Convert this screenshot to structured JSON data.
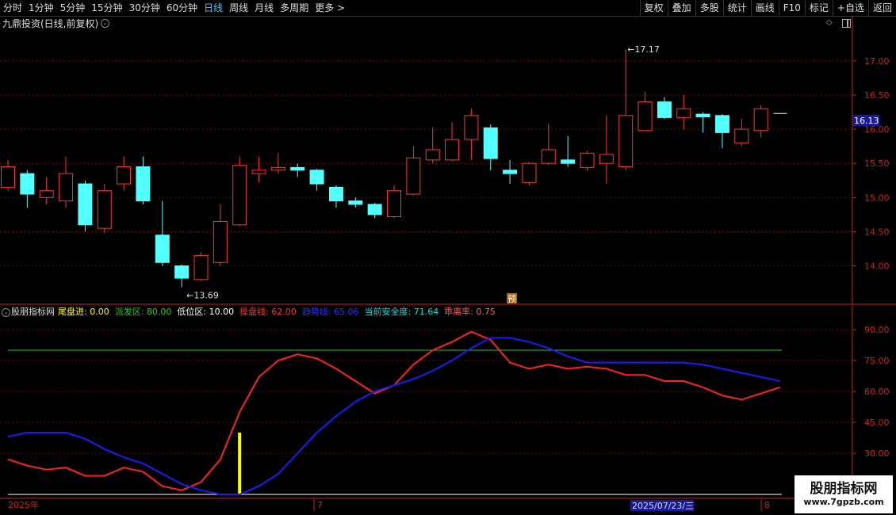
{
  "toolbar": {
    "periods": [
      "分时",
      "1分钟",
      "5分钟",
      "15分钟",
      "30分钟",
      "60分钟",
      "日线",
      "周线",
      "月线",
      "多周期",
      "更多 >"
    ],
    "active_period": "日线",
    "tools": [
      "复权",
      "叠加",
      "多股",
      "统计",
      "画线",
      "F10",
      "标记",
      "+自选",
      "返回"
    ]
  },
  "stock_title": "九鼎投资(日线,前复权)",
  "price_tags": {
    "last": "16.13",
    "high": "17.17",
    "low": "13.69",
    "marker": "预"
  },
  "colors": {
    "up": "#ff3333",
    "down": "#54ffff",
    "grid": "#7a0000",
    "axis": "#cc2222",
    "bg": "#000000",
    "kdj_line": "#ff2020",
    "trend_line": "#1a1aff",
    "ref_line": "#22cc22",
    "signal": "#ffff00"
  },
  "indicator": {
    "name": "股朋指标网",
    "fields": [
      {
        "label": "尾盘进: ",
        "value": "0.00",
        "color": "#ffff00"
      },
      {
        "label": "派发区: ",
        "value": "80.00",
        "color": "#22cc22"
      },
      {
        "label": "低位区: ",
        "value": "10.00",
        "color": "#ffffff"
      },
      {
        "label": "操盘线: ",
        "value": "62.00",
        "color": "#ff3030"
      },
      {
        "label": "趋势线: ",
        "value": "65.06",
        "color": "#2e2eff"
      },
      {
        "label": "当前安全度: ",
        "value": "71.64",
        "color": "#00e0e0"
      },
      {
        "label": "乖离率: ",
        "value": "0.75",
        "color": "#ff6060"
      }
    ]
  },
  "bottom_axis": {
    "year": "2025年",
    "month": "7",
    "cursor_date": "2025/07/23/三",
    "next_month": "8"
  },
  "watermark": {
    "line1": "股朋指标网",
    "line2": "www.7gpzb.com"
  },
  "chart_data": [
    {
      "type": "candlestick",
      "title": "九鼎投资(日线,前复权)",
      "yaxis_ticks": [
        14.0,
        14.5,
        15.0,
        15.5,
        16.0,
        16.5,
        17.0
      ],
      "ylim": [
        13.45,
        17.45
      ],
      "candles": [
        {
          "o": 15.15,
          "c": 15.45,
          "h": 15.55,
          "l": 15.1
        },
        {
          "o": 15.35,
          "c": 15.05,
          "h": 15.4,
          "l": 14.85
        },
        {
          "o": 15.0,
          "c": 15.1,
          "h": 15.3,
          "l": 14.9
        },
        {
          "o": 14.95,
          "c": 15.35,
          "h": 15.6,
          "l": 14.85
        },
        {
          "o": 15.2,
          "c": 14.6,
          "h": 15.25,
          "l": 14.5
        },
        {
          "o": 14.55,
          "c": 15.1,
          "h": 15.2,
          "l": 14.48
        },
        {
          "o": 15.2,
          "c": 15.45,
          "h": 15.6,
          "l": 15.1
        },
        {
          "o": 15.45,
          "c": 14.95,
          "h": 15.6,
          "l": 14.9
        },
        {
          "o": 14.45,
          "c": 14.05,
          "h": 14.95,
          "l": 14.0
        },
        {
          "o": 14.0,
          "c": 13.82,
          "h": 14.02,
          "l": 13.69
        },
        {
          "o": 13.8,
          "c": 14.15,
          "h": 14.2,
          "l": 13.78
        },
        {
          "o": 14.05,
          "c": 14.65,
          "h": 14.9,
          "l": 14.0
        },
        {
          "o": 14.6,
          "c": 15.47,
          "h": 15.6,
          "l": 14.58
        },
        {
          "o": 15.35,
          "c": 15.4,
          "h": 15.6,
          "l": 15.22
        },
        {
          "o": 15.4,
          "c": 15.44,
          "h": 15.65,
          "l": 15.35
        },
        {
          "o": 15.44,
          "c": 15.4,
          "h": 15.5,
          "l": 15.3
        },
        {
          "o": 15.4,
          "c": 15.2,
          "h": 15.42,
          "l": 15.1
        },
        {
          "o": 15.15,
          "c": 14.95,
          "h": 15.18,
          "l": 14.85
        },
        {
          "o": 14.95,
          "c": 14.9,
          "h": 15.0,
          "l": 14.85
        },
        {
          "o": 14.9,
          "c": 14.75,
          "h": 14.92,
          "l": 14.7
        },
        {
          "o": 14.72,
          "c": 15.1,
          "h": 15.18,
          "l": 14.7
        },
        {
          "o": 15.05,
          "c": 15.58,
          "h": 15.75,
          "l": 15.03
        },
        {
          "o": 15.55,
          "c": 15.7,
          "h": 16.02,
          "l": 15.5
        },
        {
          "o": 15.55,
          "c": 15.85,
          "h": 16.1,
          "l": 15.53
        },
        {
          "o": 15.85,
          "c": 16.2,
          "h": 16.3,
          "l": 15.55
        },
        {
          "o": 16.02,
          "c": 15.57,
          "h": 16.07,
          "l": 15.4
        },
        {
          "o": 15.4,
          "c": 15.35,
          "h": 15.55,
          "l": 15.2
        },
        {
          "o": 15.22,
          "c": 15.5,
          "h": 15.52,
          "l": 15.18
        },
        {
          "o": 15.5,
          "c": 15.7,
          "h": 16.08,
          "l": 15.48
        },
        {
          "o": 15.55,
          "c": 15.5,
          "h": 15.9,
          "l": 15.45
        },
        {
          "o": 15.44,
          "c": 15.65,
          "h": 15.68,
          "l": 15.4
        },
        {
          "o": 15.5,
          "c": 15.63,
          "h": 16.2,
          "l": 15.2
        },
        {
          "o": 15.45,
          "c": 16.2,
          "h": 17.17,
          "l": 15.4
        },
        {
          "o": 15.98,
          "c": 16.4,
          "h": 16.55,
          "l": 15.97
        },
        {
          "o": 16.4,
          "c": 16.17,
          "h": 16.47,
          "l": 16.15
        },
        {
          "o": 16.17,
          "c": 16.3,
          "h": 16.5,
          "l": 16.0
        },
        {
          "o": 16.22,
          "c": 16.18,
          "h": 16.25,
          "l": 15.95
        },
        {
          "o": 16.2,
          "c": 15.95,
          "h": 16.22,
          "l": 15.72
        },
        {
          "o": 15.8,
          "c": 16.0,
          "h": 16.15,
          "l": 15.75
        },
        {
          "o": 15.98,
          "c": 16.3,
          "h": 16.35,
          "l": 15.88
        },
        {
          "o": 16.23,
          "c": 16.23,
          "h": 16.23,
          "l": 16.23
        }
      ]
    },
    {
      "type": "line",
      "title": "股朋指标网",
      "yaxis_ticks": [
        30.0,
        45.0,
        60.0,
        75.0,
        90.0
      ],
      "ylim": [
        10.0,
        95.0
      ],
      "reference_lines": [
        {
          "name": "派发区",
          "value": 80.0
        },
        {
          "name": "低位区",
          "value": 10.0
        }
      ],
      "signal_bars": [
        {
          "x": 12,
          "value": 40.0,
          "base": 10.0
        }
      ],
      "series": [
        {
          "name": "操盘线",
          "values": [
            27,
            24,
            22,
            23,
            19,
            19,
            23,
            21,
            14,
            12,
            16,
            27,
            50,
            67,
            75,
            78,
            76,
            71,
            65,
            59,
            63,
            73,
            80,
            84,
            89,
            85,
            74,
            71,
            73,
            71,
            72,
            71,
            68,
            68,
            65,
            65,
            62,
            58,
            56,
            59,
            62
          ]
        },
        {
          "name": "趋势线",
          "values": [
            38,
            40,
            40,
            40,
            37,
            32,
            28,
            25,
            20,
            15,
            12,
            10,
            10,
            14,
            20,
            30,
            40,
            48,
            55,
            60,
            63,
            66,
            70,
            75,
            81,
            86,
            86,
            84,
            81,
            77,
            74,
            74,
            74,
            74,
            74,
            74,
            73,
            71,
            69,
            67,
            65
          ]
        }
      ]
    }
  ]
}
